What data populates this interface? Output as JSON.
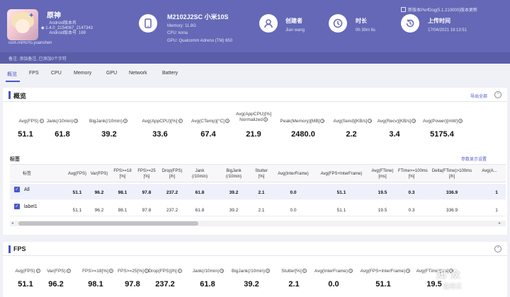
{
  "app": {
    "name": "原神",
    "android_version_label": "Android版本名",
    "version": "1.4.0_2154067_2147343",
    "android_version_code_label": "Android版本号",
    "version_code": "169",
    "package": "com.miHoYo.yuanshen"
  },
  "device": {
    "model": "M2102J2SC 小米10S",
    "memory": "Memory: 11.8G",
    "cpu": "CPU: kona",
    "gpu": "GPU: Qualcomm Adreno (TM) 650"
  },
  "creator": {
    "label": "创建者",
    "value": "Jian wang"
  },
  "duration": {
    "label": "时长",
    "value": "0h 30m 6s"
  },
  "upload": {
    "label": "上传时间",
    "value": "17/04/2021 19:13:51"
  },
  "perf_link": "新版本PerfDog(5.1.210000)版本更新",
  "header_note": "备注: 添加备注, 已添加0个字符",
  "tabs": [
    "概览",
    "FPS",
    "CPU",
    "Memory",
    "GPU",
    "Network",
    "Battery"
  ],
  "overview": {
    "title": "概览",
    "export_label": "导出全部",
    "metrics": [
      {
        "label": "Avg(FPS)",
        "value": "51.1"
      },
      {
        "label": "Jank(/10min)",
        "value": "61.8"
      },
      {
        "label": "BigJank(/10min)",
        "value": "39.2"
      },
      {
        "label": "Avg(AppCPU)[%]",
        "value": "33.6"
      },
      {
        "label": "Avg(CTemp)[°C]",
        "value": "67.4"
      },
      {
        "label": "Avg(AppCPU)[%] Normalized",
        "value": "21.9"
      },
      {
        "label": "Peak(Memory)[MB]",
        "value": "2480.0"
      },
      {
        "label": "Avg(Send)[KB/s]",
        "value": "2.2"
      },
      {
        "label": "Avg(Recv)[KB/s]",
        "value": "3.4"
      },
      {
        "label": "Avg(Power)[mW]",
        "value": "5175.4"
      }
    ],
    "tag_label": "标签",
    "param_link": "参数显示设置",
    "table": {
      "columns": [
        "标签",
        "Avg(FPS)",
        "Var(FPS)",
        "FPS>=18 [%]",
        "FPS>=25 [%]",
        "Drop(FPS) [/h]",
        "Jank (/10min)",
        "BigJank (/10min)",
        "Stutter [%]",
        "Avg(InterFrame)",
        "Avg(FPS+InterFrame)",
        "Avg(FTime) [ms]",
        "FTime>=100ms [%]",
        "Delta(FTime)>100ms [/h]",
        "Avg(A..."
      ],
      "rows": [
        {
          "name": "All",
          "values": [
            "51.1",
            "96.2",
            "98.1",
            "97.8",
            "237.2",
            "61.8",
            "39.2",
            "2.1",
            "0.0",
            "51.1",
            "19.5",
            "0.3",
            "336.9",
            "1"
          ]
        },
        {
          "name": "label1",
          "values": [
            "51.1",
            "96.2",
            "98.1",
            "97.8",
            "237.2",
            "61.8",
            "39.2",
            "2.1",
            "0.0",
            "51.1",
            "19.5",
            "0.3",
            "336.9",
            "1"
          ]
        }
      ]
    }
  },
  "fps": {
    "title": "FPS",
    "metrics": [
      {
        "label": "Avg(FPS)",
        "value": "51.1"
      },
      {
        "label": "Var(FPS)",
        "value": "96.2"
      },
      {
        "label": "FPS>=18[%]",
        "value": "98.1"
      },
      {
        "label": "FPS>=25[%]",
        "value": "97.8"
      },
      {
        "label": "Drop(FPS)[/h]",
        "value": "237.2"
      },
      {
        "label": "Jank(/10min)",
        "value": "61.8"
      },
      {
        "label": "BigJank(/10min)",
        "value": "39.2"
      },
      {
        "label": "Stutter[%]",
        "value": "2.1"
      },
      {
        "label": "Avg(InterFrame)",
        "value": "0.0"
      },
      {
        "label": "Avg(FPS+InterFrame)",
        "value": "51.1"
      },
      {
        "label": "Avg(FTime)[ms]",
        "value": "19.5"
      }
    ]
  },
  "watermark": {
    "main": "知 众",
    "sub": "值得买"
  }
}
